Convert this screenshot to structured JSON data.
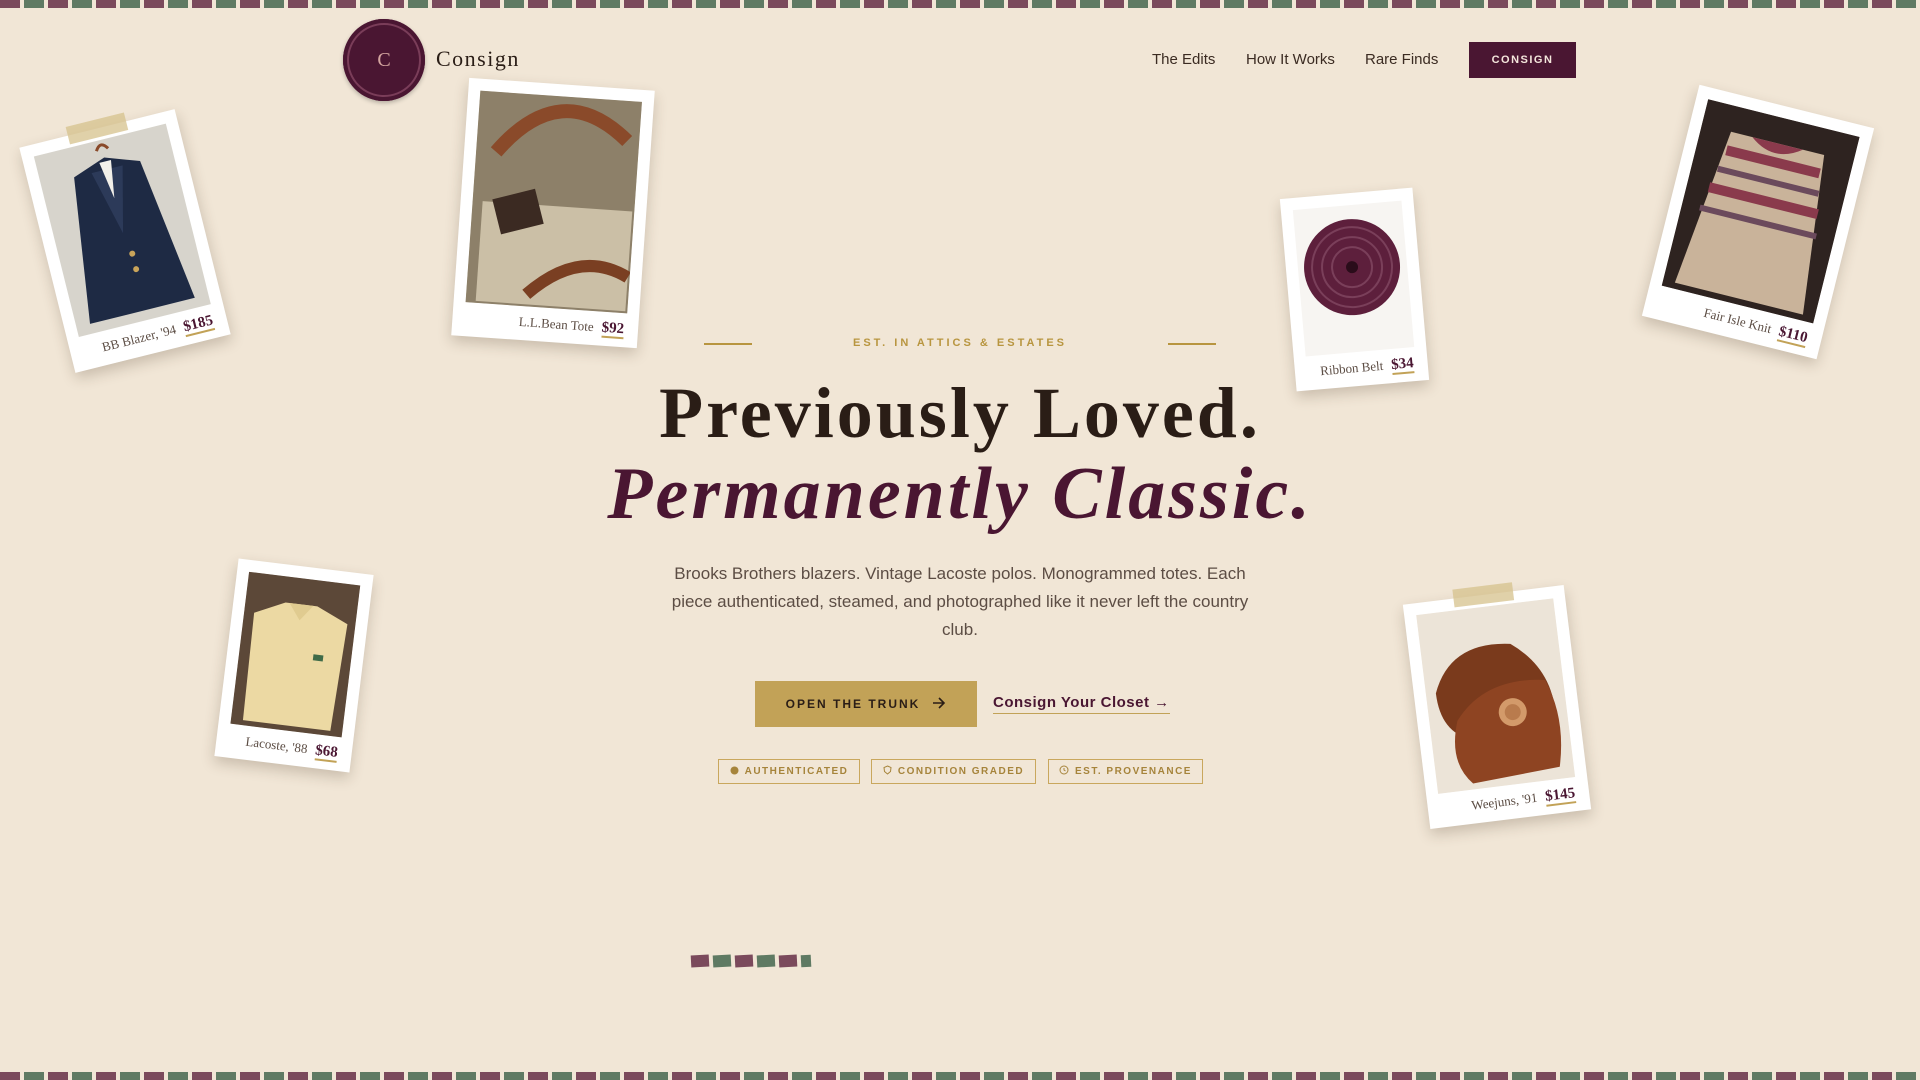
{
  "brand": {
    "logo_letter": "C",
    "name": "Consign"
  },
  "nav": {
    "items": [
      "The Edits",
      "How It Works",
      "Rare Finds"
    ],
    "cta": "CONSIGN"
  },
  "hero": {
    "eyebrow": "EST. IN ATTICS & ESTATES",
    "headline_1": "Previously Loved.",
    "headline_2": "Permanently Classic.",
    "lede": "Brooks Brothers blazers. Vintage Lacoste polos. Monogrammed totes. Each piece authenticated, steamed, and photographed like it never left the country club.",
    "cta_primary": "OPEN THE TRUNK",
    "cta_secondary": "Consign Your Closet →",
    "badges": [
      "AUTHENTICATED",
      "CONDITION GRADED",
      "EST. PROVENANCE"
    ]
  },
  "items": [
    {
      "caption": "BB Blazer, '94",
      "price": "$185"
    },
    {
      "caption": "L.L.Bean Tote",
      "price": "$92"
    },
    {
      "caption": "Ribbon Belt",
      "price": "$34"
    },
    {
      "caption": "Fair Isle Knit",
      "price": "$110"
    },
    {
      "caption": "Lacoste, '88",
      "price": "$68"
    },
    {
      "caption": "Weejuns, '91",
      "price": "$145"
    }
  ],
  "colors": {
    "background": "#f1e6d6",
    "burgundy": "#4a1632",
    "gold": "#c2a257",
    "ribbon_rose": "#7b4a5c",
    "ribbon_green": "#5f7a63"
  },
  "icons": [
    "arrow-right-icon",
    "seal-icon",
    "shield-icon",
    "clock-icon"
  ]
}
